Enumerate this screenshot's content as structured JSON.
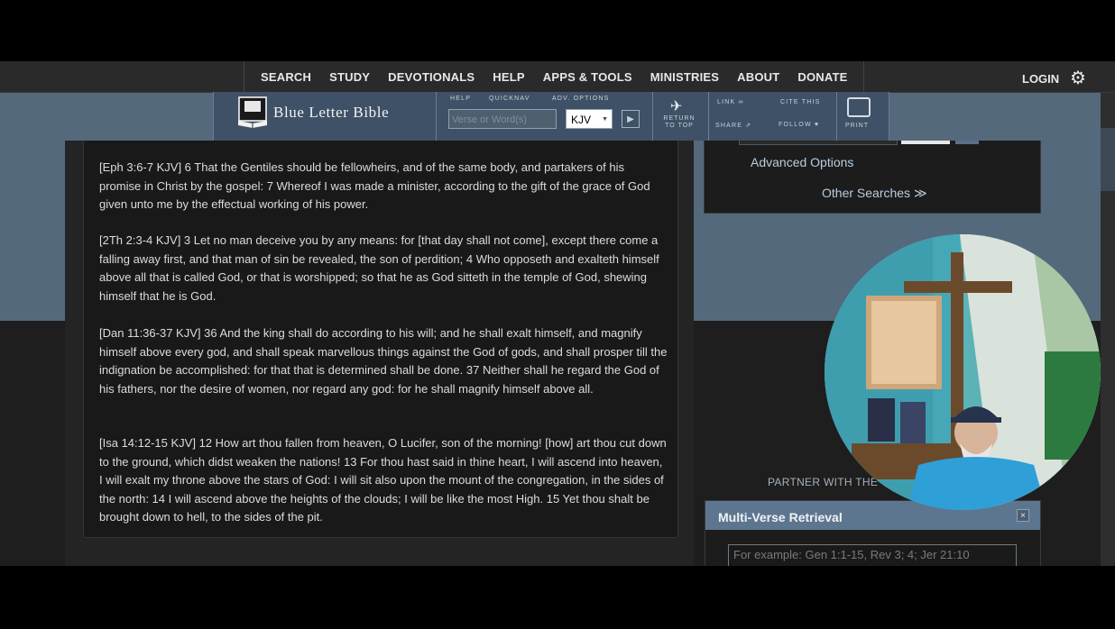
{
  "nav": {
    "links": [
      "SEARCH",
      "STUDY",
      "DEVOTIONALS",
      "HELP",
      "APPS & TOOLS",
      "MINISTRIES",
      "ABOUT",
      "DONATE"
    ],
    "login": "LOGIN"
  },
  "toolbar": {
    "brand": "Blue Letter Bible",
    "help_label": "HELP",
    "quicknav_label": "QUICKNAV",
    "adv_options_label": "ADV. OPTIONS",
    "search_placeholder": "Verse or Word(s)",
    "version": "KJV",
    "return_to_top": "RETURN TO TOP",
    "link_label": "LINK",
    "share_label": "SHARE",
    "cite_label": "CITE THIS",
    "follow_label": "FOLLOW",
    "print_label": "PRINT"
  },
  "verses": [
    "[Eph 3:6-7 KJV] 6 That the Gentiles should be fellowheirs, and of the same body, and partakers of his promise in Christ by the gospel: 7 Whereof I was made a minister, according to the gift of the grace of God given unto me by the effectual working of his power.",
    "[2Th 2:3-4 KJV] 3 Let no man deceive you by any means: for [that day shall not come], except there come a falling away first, and that man of sin be revealed, the son of perdition; 4 Who opposeth and exalteth himself above all that is called God, or that is worshipped; so that he as God sitteth in the temple of God, shewing himself that he is God.",
    "[Dan 11:36-37 KJV] 36 And the king shall do according to his will; and he shall exalt himself, and magnify himself above every god, and shall speak marvellous things against the God of gods, and shall prosper till the indignation be accomplished: for that that is determined shall be done. 37 Neither shall he regard the God of his fathers, nor the desire of women, nor regard any god: for he shall magnify himself above all.",
    "[Isa 14:12-15 KJV] 12 How art thou fallen from heaven, O Lucifer, son of the morning! [how] art thou cut down to the ground, which didst weaken the nations! 13 For thou hast said in thine heart, I will ascend into heaven, I will exalt my throne above the stars of God: I will sit also upon the mount of the congregation, in the sides of the north: 14 I will ascend above the heights of the clouds; I will be like the most High. 15 Yet thou shalt be brought down to hell, to the sides of the pit."
  ],
  "side": {
    "advanced_options": "Advanced Options",
    "other_searches": "Other Searches ≫",
    "partner": "PARTNER WITH THE"
  },
  "mvr": {
    "title": "Multi-Verse Retrieval",
    "close": "×",
    "placeholder": "For example: Gen 1:1-15, Rev 3; 4; Jer 21:10"
  },
  "colors": {
    "nav_bg": "#2a2a2a",
    "toolbar_bg": "#3e5166",
    "page_blue": "#55697c",
    "link_blue": "#b9cde0"
  }
}
